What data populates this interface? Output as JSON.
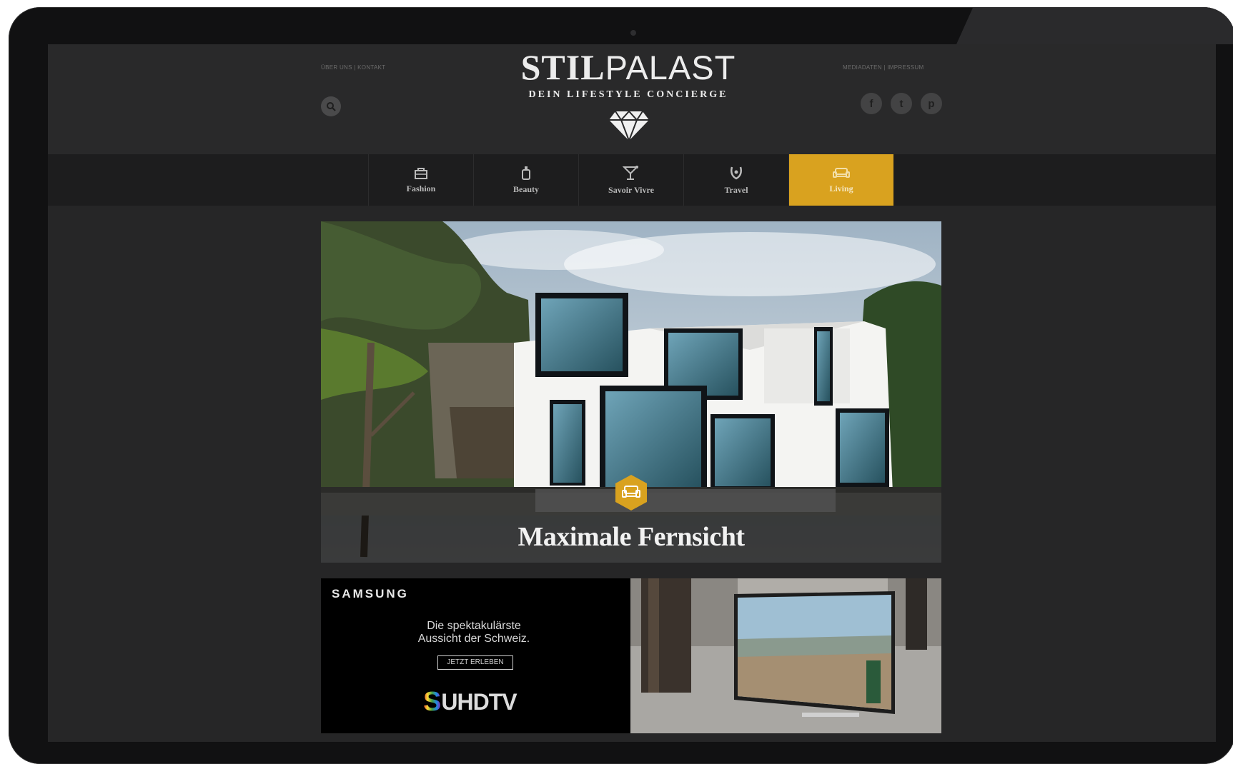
{
  "header": {
    "links_left": "ÜBER UNS | KONTAKT",
    "links_right": "MEDIADATEN | IMPRESSUM",
    "logo_bold": "STIL",
    "logo_light": "PALAST",
    "tagline": "DEIN LIFESTYLE CONCIERGE",
    "socials": [
      {
        "label": "f",
        "icon": "facebook-icon"
      },
      {
        "label": "t",
        "icon": "twitter-icon"
      },
      {
        "label": "p",
        "icon": "pinterest-icon"
      }
    ]
  },
  "nav": {
    "items": [
      {
        "label": "Fashion",
        "icon": "bag-icon",
        "active": false
      },
      {
        "label": "Beauty",
        "icon": "perfume-icon",
        "active": false
      },
      {
        "label": "Savoir Vivre",
        "icon": "cocktail-icon",
        "active": false
      },
      {
        "label": "Travel",
        "icon": "travel-icon",
        "active": false
      },
      {
        "label": "Living",
        "icon": "sofa-icon",
        "active": true
      }
    ]
  },
  "hero": {
    "title": "Maximale Fernsicht",
    "badge_icon": "sofa-icon"
  },
  "ad": {
    "brand": "SAMSUNG",
    "copy_line1": "Die spektakulärste",
    "copy_line2": "Aussicht der Schweiz.",
    "cta": "JETZT ERLEBEN",
    "product_s": "S",
    "product_text": "UHDTV"
  },
  "colors": {
    "accent": "#d9a21f",
    "background": "#262627",
    "header": "#29292a",
    "nav": "#1d1d1e"
  }
}
